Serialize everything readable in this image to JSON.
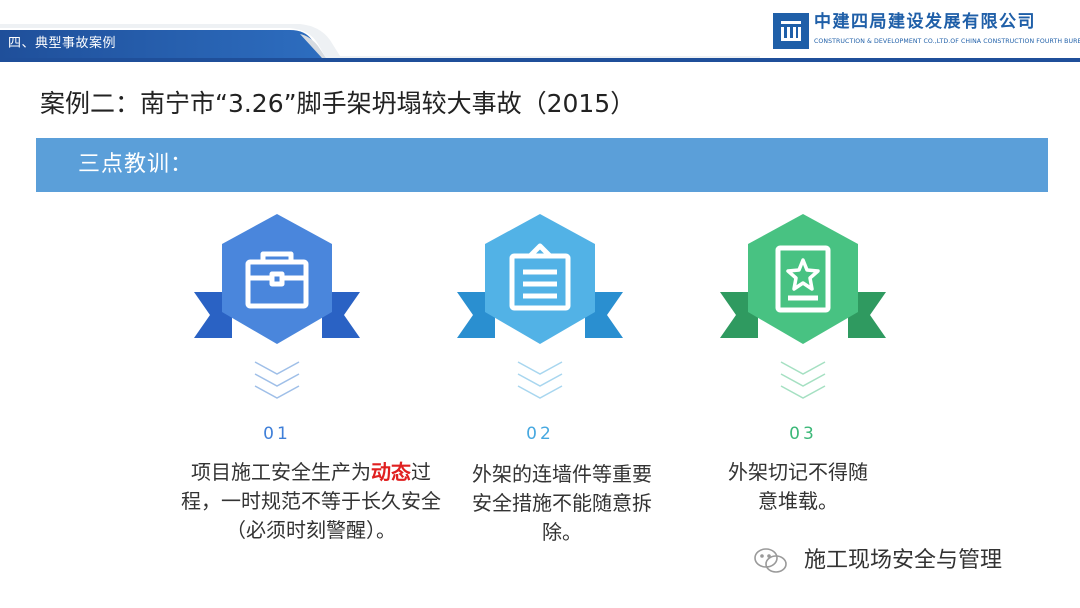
{
  "header": {
    "section": "四、典型事故案例",
    "company_cn": "中建四局建设发展有限公司",
    "company_en": "CONSTRUCTION & DEVELOPMENT CO.,LTD.OF CHINA CONSTRUCTION FOURTH BUREAU",
    "brand_color": "#1f5fa8"
  },
  "title": "案例二：南宁市“3.26”脚手架坍塌较大事故（2015）",
  "lessons_header": "三点教训：",
  "lessons": [
    {
      "icon": "toolbox-icon",
      "number": "01",
      "color": "#3f7fd8",
      "text_before": "项目施工安全生产为",
      "highlight": "动态",
      "text_after": "过程，一时规范不等于长久安全（必须时刻警醒）。"
    },
    {
      "icon": "document-icon",
      "number": "02",
      "color": "#46a8e0",
      "text": "外架的连墙件等重要安全措施不能随意拆除。"
    },
    {
      "icon": "certificate-star-icon",
      "number": "03",
      "color": "#3cb878",
      "text": "外架切记不得随意堆载。"
    }
  ],
  "watermark": "施工现场安全与管理"
}
